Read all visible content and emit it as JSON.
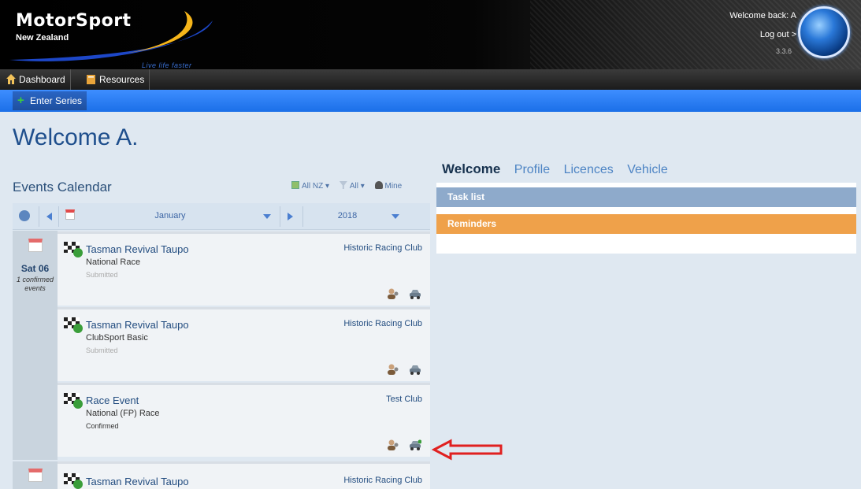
{
  "header": {
    "logo_title": "MotorSport",
    "logo_subtitle": "New Zealand",
    "logo_tagline": "Live life faster",
    "welcome_back": "Welcome back: A",
    "logout": "Log out >",
    "version": "3.3.6"
  },
  "nav": {
    "items": [
      {
        "label": "Dashboard",
        "icon": "home-icon"
      },
      {
        "label": "Resources",
        "icon": "book-icon"
      }
    ]
  },
  "subnav": {
    "enter_series": "Enter Series"
  },
  "page": {
    "title": "Welcome A."
  },
  "calendar": {
    "title": "Events Calendar",
    "filters": {
      "region": "All NZ",
      "filter": "All",
      "mine": "Mine"
    },
    "month": "January",
    "year": "2018",
    "dates": [
      {
        "day": "Sat 06",
        "sub": "1 confirmed events"
      }
    ],
    "events": [
      {
        "name": "Tasman Revival Taupo",
        "type": "National Race",
        "status": "Submitted",
        "club": "Historic Racing Club"
      },
      {
        "name": "Tasman Revival Taupo",
        "type": "ClubSport Basic",
        "status": "Submitted",
        "club": "Historic Racing Club"
      },
      {
        "name": "Race Event",
        "type": "National (FP) Race",
        "status": "Confirmed",
        "club": "Test Club"
      },
      {
        "name": "Tasman Revival Taupo",
        "type": "",
        "status": "",
        "club": "Historic Racing Club"
      }
    ]
  },
  "right_panel": {
    "tabs": [
      "Welcome",
      "Profile",
      "Licences",
      "Vehicle"
    ],
    "active_tab": "Welcome",
    "task_list": "Task list",
    "reminders": "Reminders"
  },
  "colors": {
    "brand_blue": "#1b6fe8",
    "task_bar": "#8eaacb",
    "reminder_bar": "#efa14a",
    "annotation_arrow": "#e02020"
  }
}
